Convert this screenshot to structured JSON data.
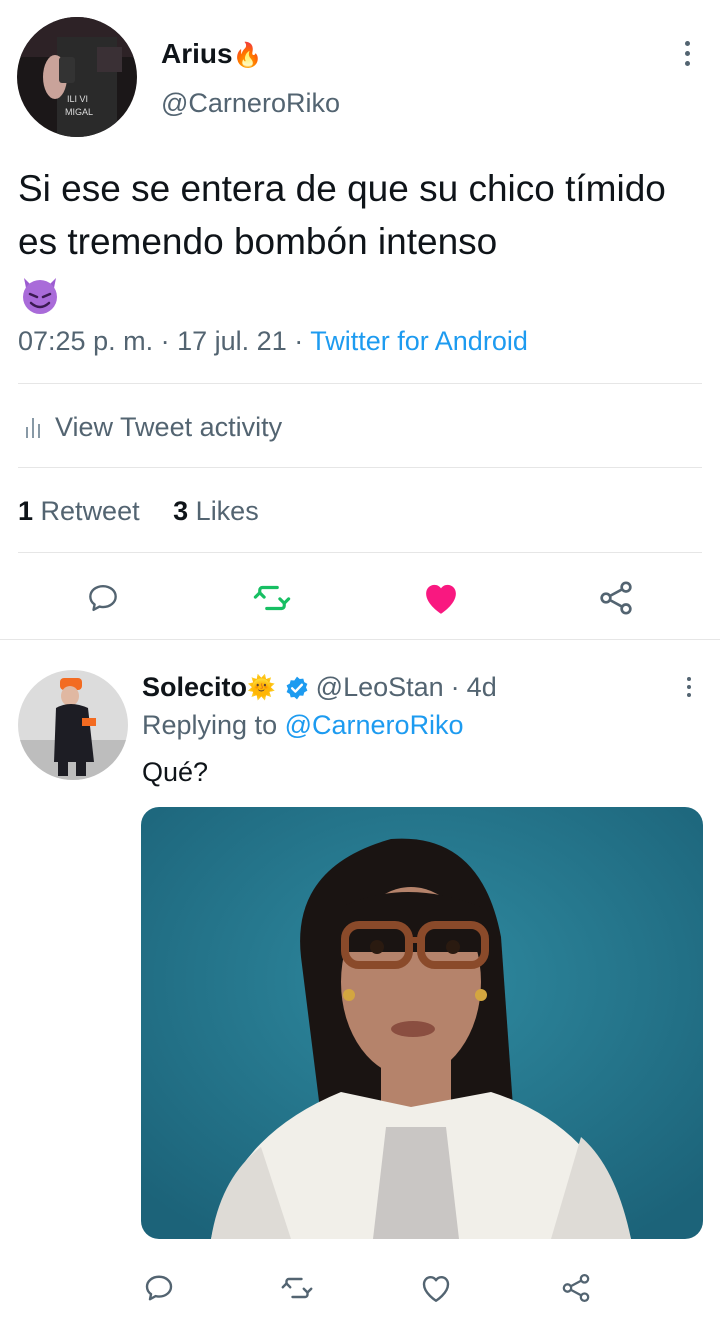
{
  "tweet": {
    "display_name": "Arius",
    "name_emoji": "🔥",
    "handle": "@CarneroRiko",
    "text": "Si ese se entera de que su chico tímido es tremendo bombón intenso",
    "text_emoji": "😈",
    "time": "07:25 p. m.",
    "separator": "·",
    "date": "17 jul. 21",
    "source": "Twitter for Android",
    "activity_label": "View Tweet activity",
    "retweet_count": "1",
    "retweet_label": "Retweet",
    "likes_count": "3",
    "likes_label": "Likes",
    "liked": true,
    "colors": {
      "retweet": "#17bf63",
      "like": "#f91880",
      "link": "#1d9bf0"
    }
  },
  "reply": {
    "display_name": "Solecito",
    "name_emoji": "🌞",
    "verified": true,
    "handle": "@LeoStan",
    "separator": "·",
    "age": "4d",
    "replying_prefix": "Replying to",
    "replying_to": "@CarneroRiko",
    "text": "Qué?"
  },
  "icons": [
    "more-vertical-icon",
    "bar-chart-icon",
    "reply-icon",
    "retweet-icon",
    "heart-icon",
    "share-icon",
    "verified-badge-icon"
  ]
}
